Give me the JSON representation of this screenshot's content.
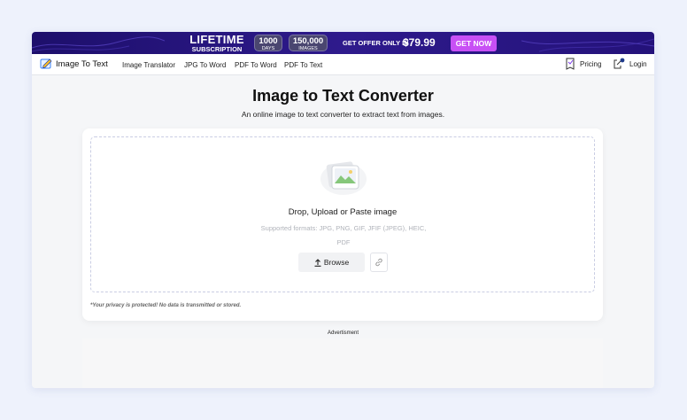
{
  "promo": {
    "title": "LIFETIME",
    "subtitle": "SUBSCRIPTION",
    "days_num": "1000",
    "days_unit": "DAYS",
    "images_num": "150,000",
    "images_unit": "IMAGES",
    "offer_text": "GET OFFER ONLY IN",
    "price": "$79.99",
    "cta": "GET NOW"
  },
  "nav": {
    "brand": "Image To Text",
    "links": [
      "Image Translator",
      "JPG To Word",
      "PDF To Word",
      "PDF To Text"
    ],
    "pricing": "Pricing",
    "login": "Login"
  },
  "main": {
    "title": "Image to Text Converter",
    "subtitle": "An online image to text converter to extract text from images.",
    "drop_label": "Drop, Upload or Paste image",
    "formats": "Supported formats: JPG, PNG, GIF, JFIF (JPEG), HEIC, PDF",
    "browse": "Browse",
    "privacy": "*Your privacy is protected! No data is transmitted or stored.",
    "ad_label": "Advertisment"
  },
  "colors": {
    "banner": "#2a1580",
    "cta": "#c850f5",
    "page_bg": "#eef2fc"
  }
}
